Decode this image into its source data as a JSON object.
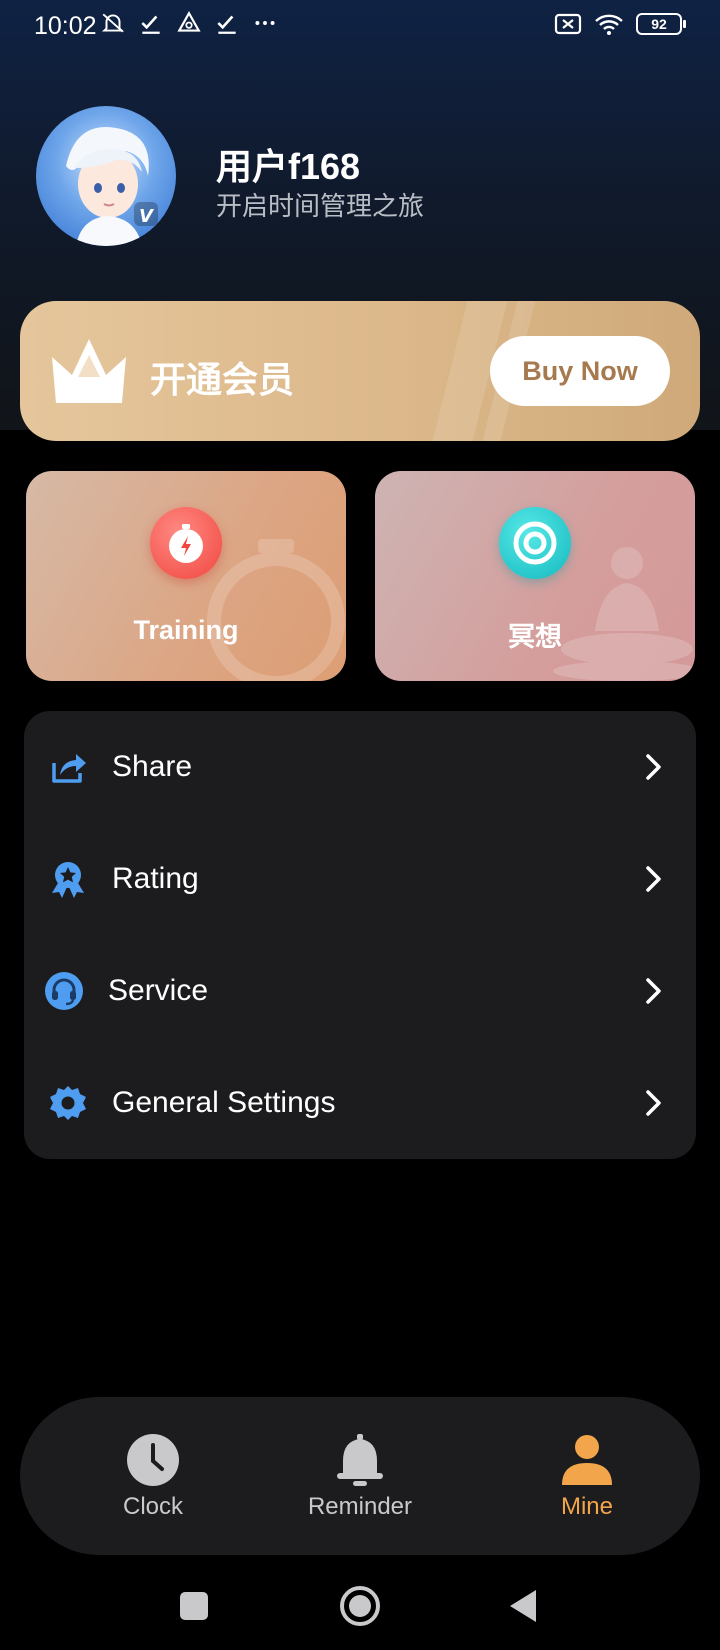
{
  "status_bar": {
    "time": "10:02",
    "battery": "92"
  },
  "profile": {
    "username": "用户f168",
    "slogan": "开启时间管理之旅"
  },
  "vip": {
    "title": "开通会员",
    "buy_label": "Buy Now"
  },
  "cards": [
    {
      "label": "Training",
      "icon": "stopwatch-icon"
    },
    {
      "label": "冥想",
      "icon": "target-icon"
    }
  ],
  "menu": {
    "items": [
      {
        "label": "Share",
        "icon": "share-icon"
      },
      {
        "label": "Rating",
        "icon": "award-icon"
      },
      {
        "label": "Service",
        "icon": "headset-icon"
      },
      {
        "label": "General Settings",
        "icon": "gear-icon"
      }
    ]
  },
  "bottom_nav": {
    "items": [
      {
        "label": "Clock",
        "icon": "clock-icon",
        "active": false
      },
      {
        "label": "Reminder",
        "icon": "bell-icon",
        "active": false
      },
      {
        "label": "Mine",
        "icon": "person-icon",
        "active": true
      }
    ]
  },
  "colors": {
    "accent": "#f2a54a",
    "vip_gold": "#dcb88a",
    "menu_icon_blue": "#4f9df0",
    "card_bg": "#1c1c1e"
  }
}
